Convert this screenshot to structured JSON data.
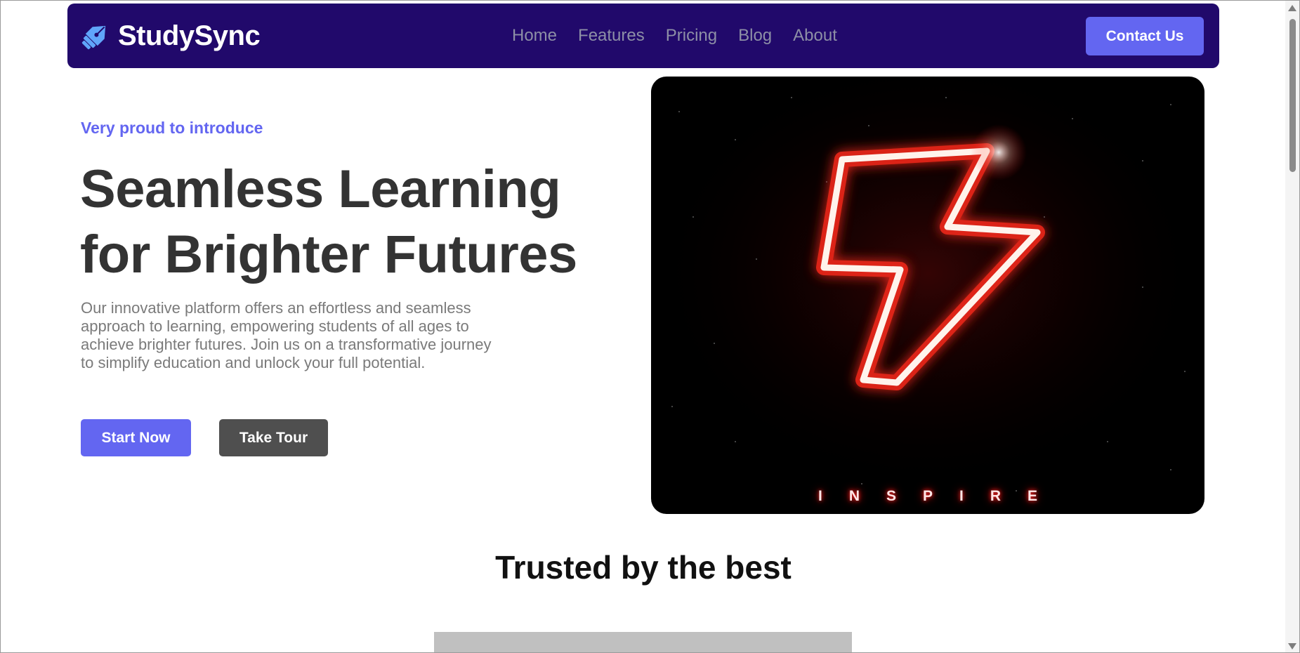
{
  "nav": {
    "brand": "StudySync",
    "brand_icon": "fountain-pen-icon",
    "links": [
      "Home",
      "Features",
      "Pricing",
      "Blog",
      "About"
    ],
    "contact_label": "Contact Us"
  },
  "hero": {
    "eyebrow": "Very proud to introduce",
    "title_line1": "Seamless Learning",
    "title_line2": "for Brighter Futures",
    "description": "Our innovative platform offers an effortless and seamless approach to learning, empowering students of all ages to achieve brighter futures. Join us on a transformative journey to simplify education and unlock your full potential.",
    "start_label": "Start Now",
    "tour_label": "Take Tour",
    "image_text": "INSPIRE",
    "image_icon": "neon-lightning-bolt-icon"
  },
  "trusted": {
    "title": "Trusted by the best"
  },
  "colors": {
    "nav_bg": "#21096b",
    "accent": "#6366f1",
    "tour_button": "#4f4f4f",
    "heading": "#333333",
    "body_text": "#7a7a7a"
  }
}
